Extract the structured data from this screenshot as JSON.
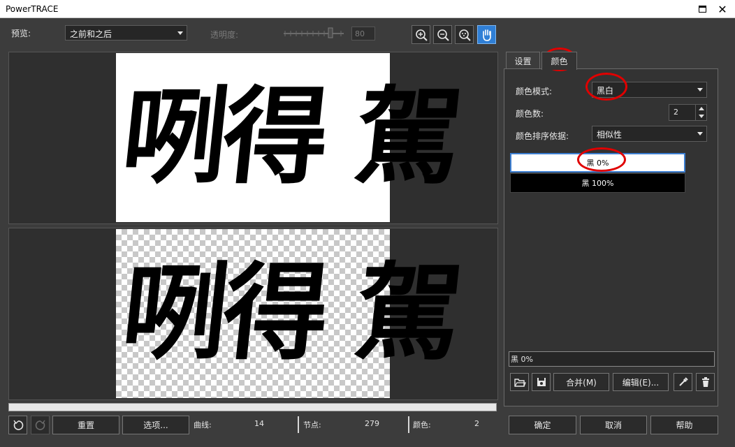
{
  "window": {
    "title": "PowerTRACE"
  },
  "toolbar": {
    "preview_label": "预览:",
    "preview_value": "之前和之后",
    "transparency_label": "透明度:",
    "transparency_value": "80",
    "transparency_fraction": 0.8,
    "zoom_in_icon": "zoom-in-icon",
    "zoom_out_icon": "zoom-out-icon",
    "zoom_fit_icon": "zoom-fit-icon",
    "pan_icon": "hand-icon"
  },
  "preview": {
    "before_text": "咧得 駕",
    "after_text": "咧得 駕"
  },
  "bottom_bar": {
    "undo_icon": "undo-icon",
    "redo_icon": "redo-icon",
    "reset_label": "重置",
    "options_label": "选项...",
    "curves_label": "曲线:",
    "curves_value": "14",
    "nodes_label": "节点:",
    "nodes_value": "279",
    "colors_label": "颜色:",
    "colors_value": "2"
  },
  "tabs": [
    {
      "label": "设置",
      "active": false
    },
    {
      "label": "颜色",
      "active": true
    }
  ],
  "color_panel": {
    "mode_label": "颜色模式:",
    "mode_value": "黑白",
    "count_label": "颜色数:",
    "count_value": "2",
    "sort_label": "颜色排序依据:",
    "sort_value": "相似性",
    "swatches": [
      {
        "label": "黑 0%",
        "color": "#ffffff",
        "selected": true
      },
      {
        "label": "黑 100%",
        "color": "#000000",
        "selected": false
      }
    ],
    "selected_info": "黑 0%",
    "open_icon": "folder-open-icon",
    "save_icon": "save-icon",
    "merge_label": "合并(M)",
    "edit_label": "编辑(E)...",
    "eyedropper_icon": "eyedropper-icon",
    "delete_icon": "trash-icon"
  },
  "dialog_buttons": {
    "ok_label": "确定",
    "cancel_label": "取消",
    "help_label": "帮助"
  },
  "colors": {
    "accent": "#2f7fd6",
    "annotation": "#e00000",
    "background": "#3c3c3c"
  }
}
